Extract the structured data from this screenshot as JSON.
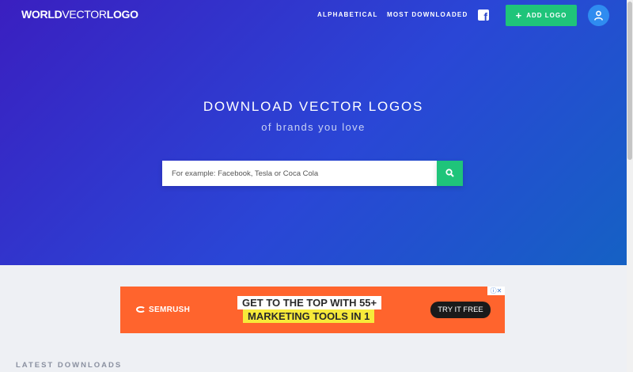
{
  "header": {
    "logo_bold": "WORLD",
    "logo_thin": "VECTOR",
    "logo_end": "LOGO",
    "nav": [
      "ALPHABETICAL",
      "MOST DOWNLOADED"
    ],
    "facebook_icon": "facebook-icon",
    "add_logo_label": "ADD LOGO",
    "user_icon": "user-icon"
  },
  "hero": {
    "title": "DOWNLOAD VECTOR LOGOS",
    "subtitle": "of brands you love",
    "search_placeholder": "For example: Facebook, Tesla or Coca Cola",
    "search_icon": "search-icon"
  },
  "ad": {
    "brand": "SEMRUSH",
    "line1": "GET TO THE TOP WITH 55+",
    "line2": "MARKETING TOOLS IN 1",
    "cta": "TRY IT FREE"
  },
  "section": {
    "latest_title": "LATEST DOWNLOADS"
  },
  "colors": {
    "accent_green": "#1fc47a",
    "hero_start": "#3a1fc0",
    "hero_end": "#1561c4",
    "ad_orange": "#ff642d"
  }
}
